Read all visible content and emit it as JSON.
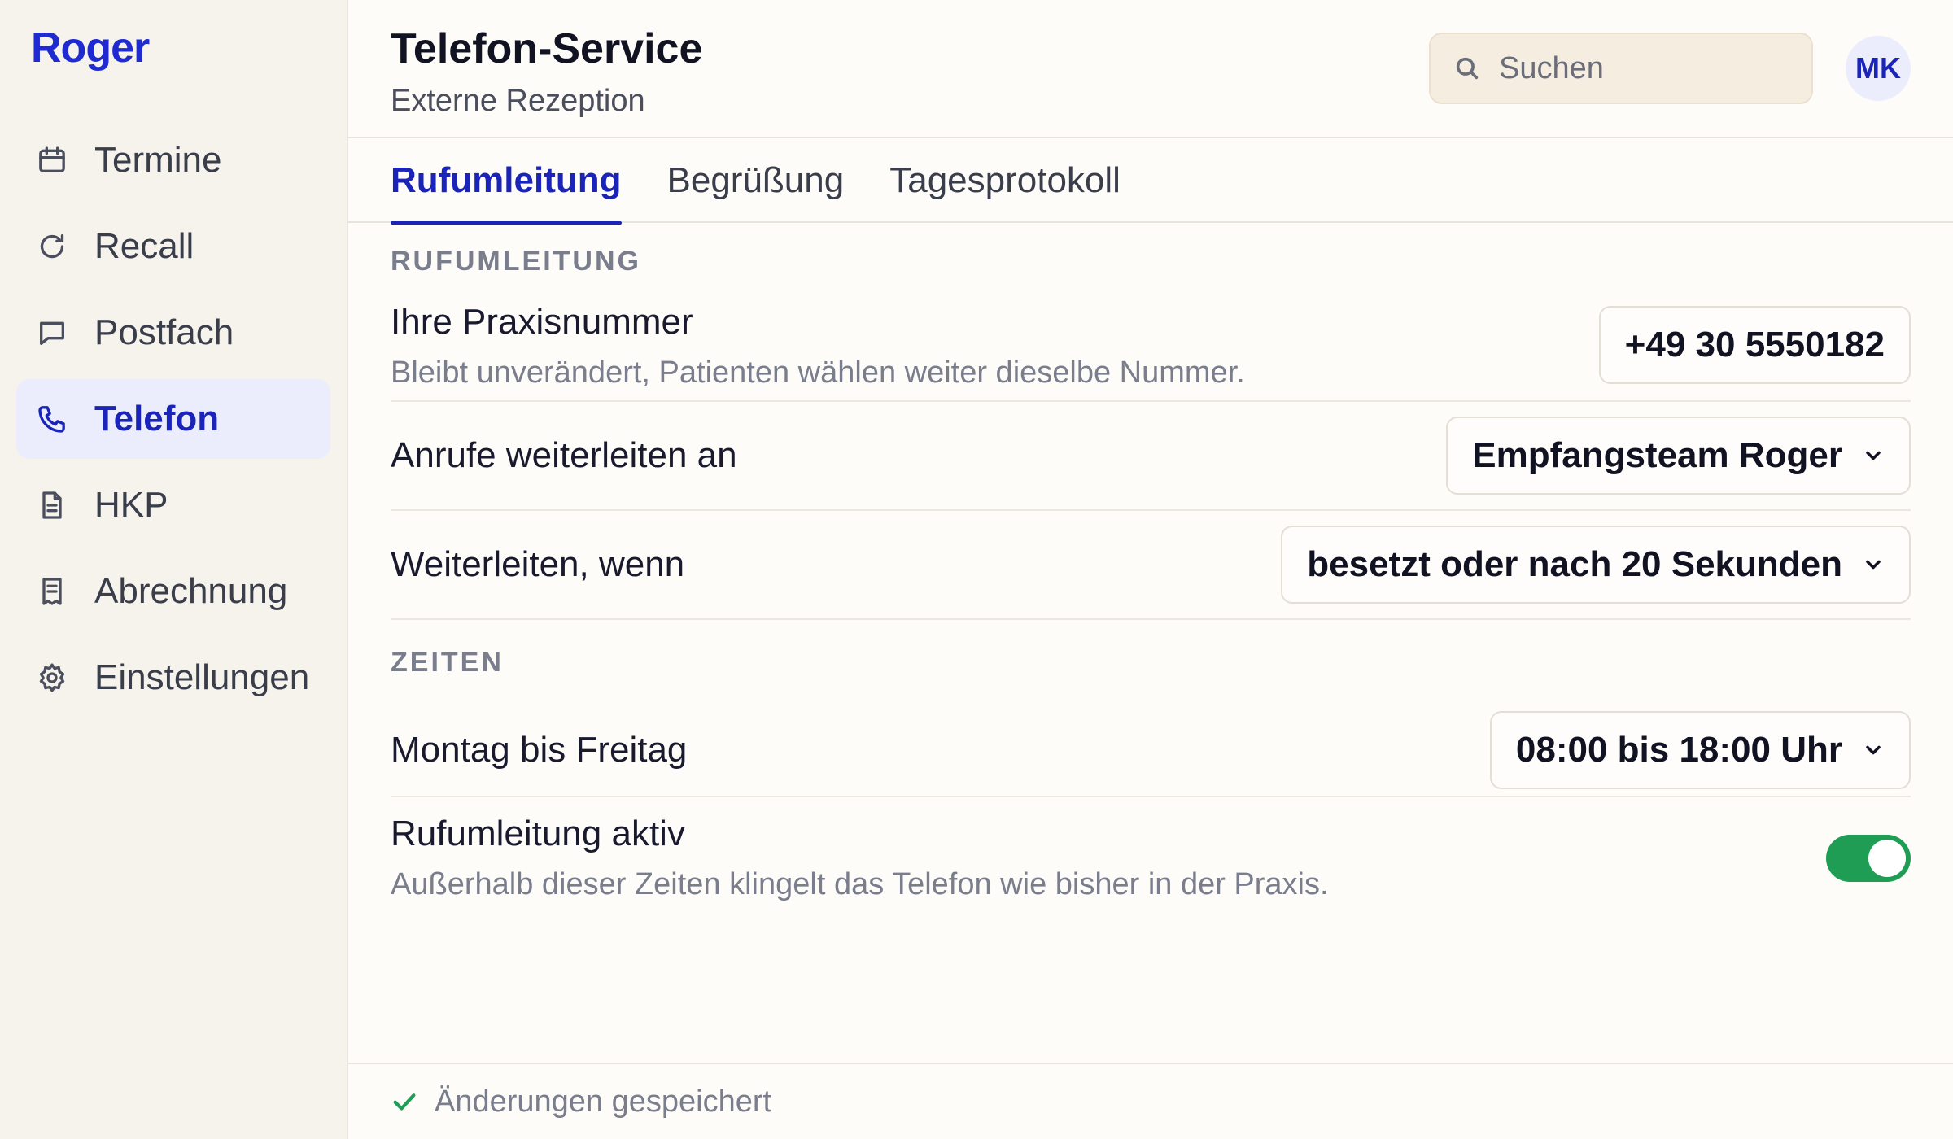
{
  "app": {
    "logo": "Roger"
  },
  "sidebar": {
    "items": [
      {
        "label": "Termine",
        "icon": "calendar-icon",
        "active": false
      },
      {
        "label": "Recall",
        "icon": "refresh-icon",
        "active": false
      },
      {
        "label": "Postfach",
        "icon": "message-icon",
        "active": false
      },
      {
        "label": "Telefon",
        "icon": "phone-icon",
        "active": true
      },
      {
        "label": "HKP",
        "icon": "document-icon",
        "active": false
      },
      {
        "label": "Abrechnung",
        "icon": "receipt-icon",
        "active": false
      },
      {
        "label": "Einstellungen",
        "icon": "gear-icon",
        "active": false
      }
    ]
  },
  "header": {
    "title": "Telefon-Service",
    "subtitle": "Externe Rezeption",
    "search_placeholder": "Suchen",
    "avatar_initials": "MK"
  },
  "tabs": [
    {
      "label": "Rufumleitung",
      "active": true
    },
    {
      "label": "Begrüßung",
      "active": false
    },
    {
      "label": "Tagesprotokoll",
      "active": false
    }
  ],
  "sections": {
    "rufumleitung": {
      "heading": "Rufumleitung",
      "praxisnummer": {
        "label": "Ihre Praxisnummer",
        "description": "Bleibt unverändert, Patienten wählen weiter dieselbe Nummer.",
        "value": "+49 30 5550182"
      },
      "weiterleiten_an": {
        "label": "Anrufe weiterleiten an",
        "value": "Empfangsteam Roger"
      },
      "weiterleiten_wenn": {
        "label": "Weiterleiten, wenn",
        "value": "besetzt oder nach 20 Sekunden"
      }
    },
    "zeiten": {
      "heading": "Zeiten",
      "wochentage": {
        "label": "Montag bis Freitag",
        "value": "08:00 bis 18:00 Uhr"
      },
      "aktiv": {
        "label": "Rufumleitung aktiv",
        "description": "Außerhalb dieser Zeiten klingelt das Telefon wie bisher in der Praxis.",
        "enabled": true
      }
    }
  },
  "footer": {
    "status": "Änderungen gespeichert"
  },
  "colors": {
    "accent": "#1a24b8",
    "success": "#1f9d55",
    "sidebar_bg": "#f6f3ed",
    "search_bg": "#f6ede1"
  }
}
